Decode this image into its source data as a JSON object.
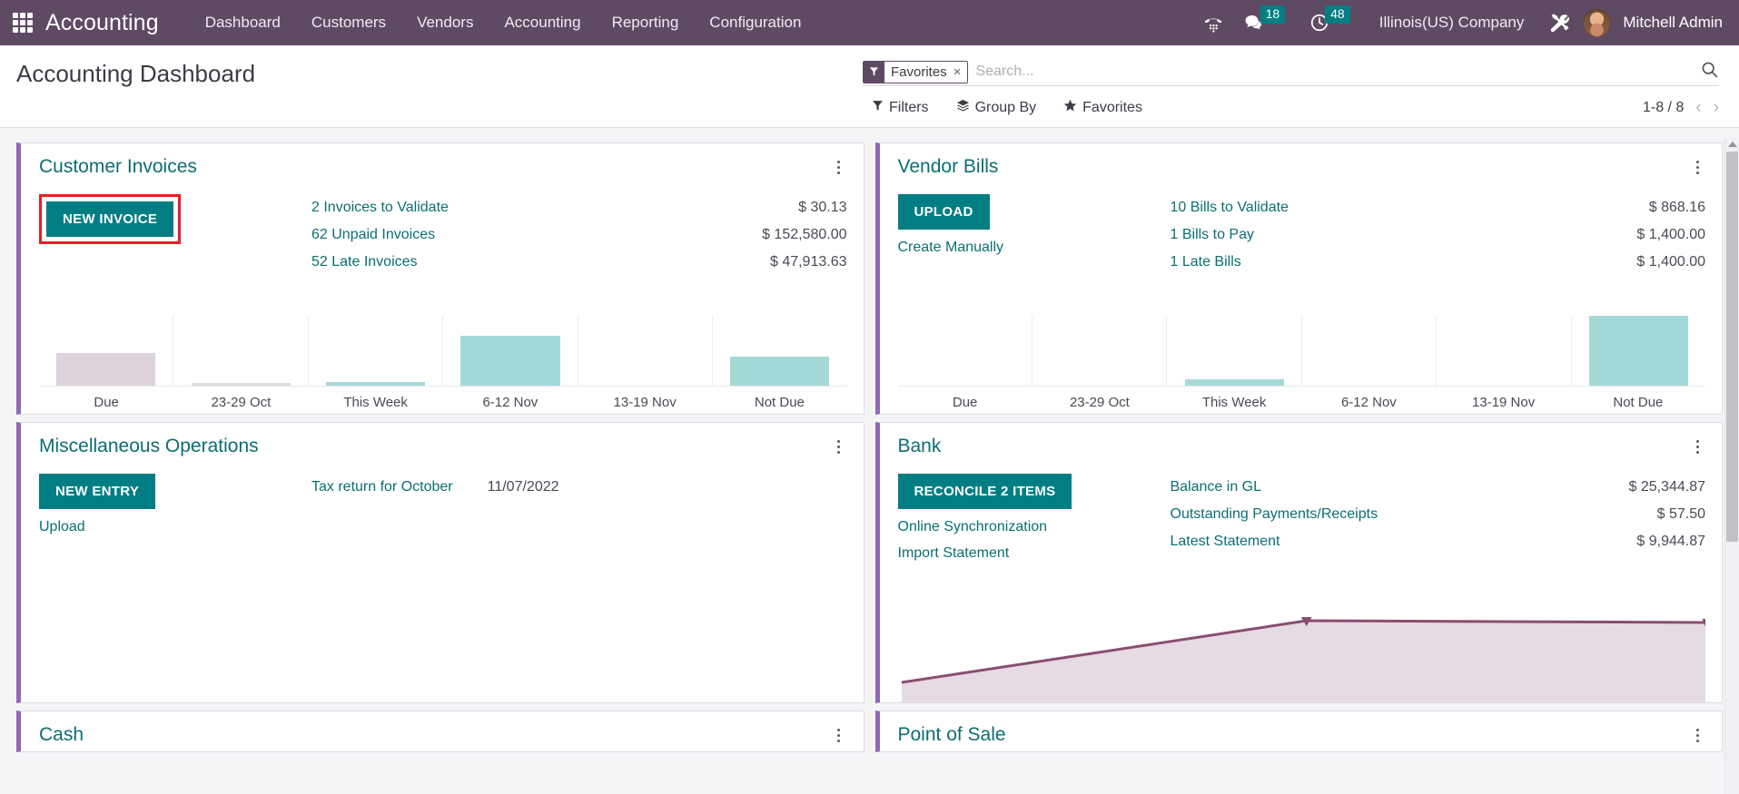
{
  "topbar": {
    "apps_icon": "apps-grid-icon",
    "app_name": "Accounting",
    "menus": [
      {
        "label": "Dashboard"
      },
      {
        "label": "Customers"
      },
      {
        "label": "Vendors"
      },
      {
        "label": "Accounting"
      },
      {
        "label": "Reporting"
      },
      {
        "label": "Configuration"
      }
    ],
    "phone_icon": "phone-dialpad-icon",
    "messages_icon": "chat-bubble-icon",
    "messages_count": "18",
    "activities_icon": "clock-icon",
    "activities_count": "48",
    "company": "Illinois(US) Company",
    "settings_icon": "tools-icon",
    "avatar_icon": "user-avatar",
    "user": "Mitchell Admin"
  },
  "control_panel": {
    "page_title": "Accounting Dashboard",
    "facet": {
      "icon": "filter-funnel-icon",
      "label": "Favorites",
      "remove": "×"
    },
    "search": {
      "placeholder": "Search...",
      "value": "",
      "icon": "search-icon"
    },
    "tools": [
      {
        "label": "Filters",
        "icon": "filter-icon"
      },
      {
        "label": "Group By",
        "icon": "layers-icon"
      },
      {
        "label": "Favorites",
        "icon": "star-icon"
      }
    ],
    "pager": {
      "count": "1-8 / 8",
      "prev": "‹",
      "next": "›"
    }
  },
  "cards": {
    "customer_invoices": {
      "title": "Customer Invoices",
      "primary_button": "NEW INVOICE",
      "highlighted": true,
      "stats": [
        {
          "label": "2 Invoices to Validate",
          "value": "$ 30.13"
        },
        {
          "label": "62 Unpaid Invoices",
          "value": "$ 152,580.00"
        },
        {
          "label": "52 Late Invoices",
          "value": "$ 47,913.63"
        }
      ]
    },
    "vendor_bills": {
      "title": "Vendor Bills",
      "primary_button": "UPLOAD",
      "secondary_link": "Create Manually",
      "stats": [
        {
          "label": "10 Bills to Validate",
          "value": "$ 868.16"
        },
        {
          "label": "1 Bills to Pay",
          "value": "$ 1,400.00"
        },
        {
          "label": "1 Late Bills",
          "value": "$ 1,400.00"
        }
      ]
    },
    "misc_operations": {
      "title": "Miscellaneous Operations",
      "primary_button": "NEW ENTRY",
      "secondary_link": "Upload",
      "entry_label": "Tax return for October",
      "entry_date": "11/07/2022"
    },
    "bank": {
      "title": "Bank",
      "primary_button": "RECONCILE 2 ITEMS",
      "links": [
        "Online Synchronization",
        "Import Statement"
      ],
      "stats": [
        {
          "label": "Balance in GL",
          "value": "$ 25,344.87"
        },
        {
          "label": "Outstanding Payments/Receipts",
          "value": "$ 57.50"
        },
        {
          "label": "Latest Statement",
          "value": "$ 9,944.87"
        }
      ]
    },
    "cash": {
      "title": "Cash"
    },
    "point_of_sale": {
      "title": "Point of Sale"
    }
  },
  "chart_data": [
    {
      "type": "bar",
      "title": "Customer Invoices aging",
      "categories": [
        "Due",
        "23-29 Oct",
        "This Week",
        "6-12 Nov",
        "13-19 Nov",
        "Not Due"
      ],
      "values": [
        47,
        1,
        2,
        72,
        0,
        42
      ],
      "colors": [
        "#ded2dc",
        "#dcdce0",
        "#a5d9d7",
        "#a5d9d7",
        "#a5d9d7",
        "#a5d9d7"
      ],
      "xlabel": "",
      "ylabel": "",
      "ylim": [
        0,
        100
      ],
      "grid": true,
      "legend": "none"
    },
    {
      "type": "bar",
      "title": "Vendor Bills aging",
      "categories": [
        "Due",
        "23-29 Oct",
        "This Week",
        "6-12 Nov",
        "13-19 Nov",
        "Not Due"
      ],
      "values": [
        0,
        0,
        6,
        0,
        0,
        100
      ],
      "colors": [
        "#a5d9d7",
        "#a5d9d7",
        "#a5d9d7",
        "#a5d9d7",
        "#a5d9d7",
        "#a5d9d7"
      ],
      "xlabel": "",
      "ylabel": "",
      "ylim": [
        0,
        100
      ],
      "grid": true,
      "legend": "none"
    },
    {
      "type": "area",
      "title": "Bank balance trend",
      "x": [
        0,
        50,
        100
      ],
      "values": [
        18,
        78,
        78
      ],
      "line_color": "#8a4d72",
      "fill_color": "#e6dae3",
      "xlabel": "",
      "ylabel": "",
      "ylim": [
        0,
        100
      ],
      "grid": false,
      "legend": "none"
    }
  ]
}
